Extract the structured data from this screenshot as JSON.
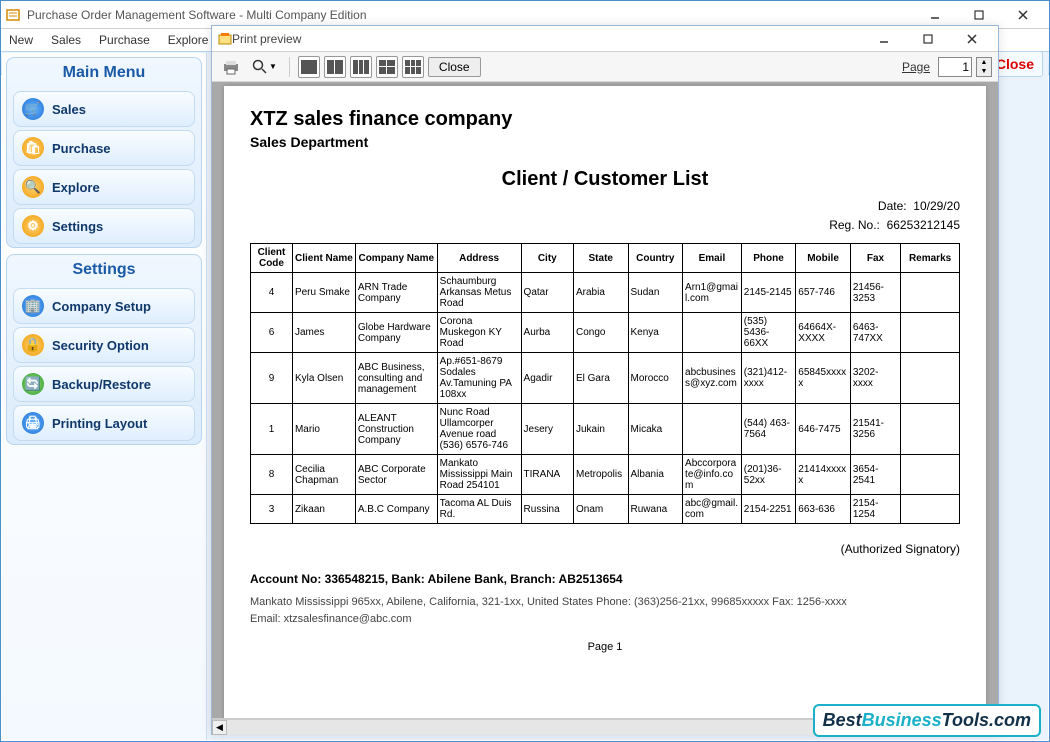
{
  "main_window": {
    "title": "Purchase Order Management Software - Multi Company Edition",
    "menu": [
      "New",
      "Sales",
      "Purchase",
      "Explore"
    ],
    "close_label": "Close"
  },
  "sidebar": {
    "main_menu_header": "Main Menu",
    "main_items": [
      {
        "label": "Sales"
      },
      {
        "label": "Purchase"
      },
      {
        "label": "Explore"
      },
      {
        "label": "Settings"
      }
    ],
    "settings_header": "Settings",
    "settings_items": [
      {
        "label": "Company Setup"
      },
      {
        "label": "Security Option"
      },
      {
        "label": "Backup/Restore"
      },
      {
        "label": "Printing Layout"
      }
    ]
  },
  "preview": {
    "title": "Print preview",
    "close_btn": "Close",
    "page_label": "Page",
    "page_value": "1"
  },
  "document": {
    "company": "XTZ sales finance company",
    "department": "Sales Department",
    "title": "Client / Customer List",
    "date_label": "Date:",
    "date_value": "10/29/20",
    "reg_label": "Reg. No.:",
    "reg_value": "66253212145",
    "columns": [
      "Client Code",
      "Client Name",
      "Company Name",
      "Address",
      "City",
      "State",
      "Country",
      "Email",
      "Phone",
      "Mobile",
      "Fax",
      "Remarks"
    ],
    "rows": [
      {
        "code": "4",
        "name": "Peru Smake",
        "company": "ARN Trade Company",
        "address": "Schaumburg Arkansas Metus Road",
        "city": "Qatar",
        "state": "Arabia",
        "country": "Sudan",
        "email": "Arn1@gmail.com",
        "phone": "2145-2145",
        "mobile": "657-746",
        "fax": "21456-3253",
        "remarks": ""
      },
      {
        "code": "6",
        "name": "James",
        "company": "Globe Hardware Company",
        "address": "Corona Muskegon KY Road",
        "city": "Aurba",
        "state": "Congo",
        "country": "Kenya",
        "email": "",
        "phone": "(535) 5436-66XX",
        "mobile": "64664X-XXXX",
        "fax": "6463-747XX",
        "remarks": ""
      },
      {
        "code": "9",
        "name": "Kyla Olsen",
        "company": "ABC Business, consulting and management",
        "address": "Ap.#651-8679 Sodales Av.Tamuning PA 108xx",
        "city": "Agadir",
        "state": "El Gara",
        "country": "Morocco",
        "email": "abcbusiness@xyz.com",
        "phone": "(321)412-xxxx",
        "mobile": "65845xxxxx",
        "fax": "3202-xxxx",
        "remarks": ""
      },
      {
        "code": "1",
        "name": "Mario",
        "company": "ALEANT Construction Company",
        "address": "Nunc Road Ullamcorper Avenue road (536) 6576-746",
        "city": "Jesery",
        "state": "Jukain",
        "country": "Micaka",
        "email": "",
        "phone": "(544) 463-7564",
        "mobile": "646-7475",
        "fax": "21541-3256",
        "remarks": ""
      },
      {
        "code": "8",
        "name": "Cecilia Chapman",
        "company": "ABC Corporate Sector",
        "address": "Mankato Mississippi Main Road 254101",
        "city": "TIRANA",
        "state": "Metropolis",
        "country": "Albania",
        "email": "Abccorporate@info.com",
        "phone": "(201)36-52xx",
        "mobile": "21414xxxxx",
        "fax": "3654-2541",
        "remarks": ""
      },
      {
        "code": "3",
        "name": "Zikaan",
        "company": "A.B.C Company",
        "address": "Tacoma AL Duis Rd.",
        "city": "Russina",
        "state": "Onam",
        "country": "Ruwana",
        "email": "abc@gmail.com",
        "phone": "2154-2251",
        "mobile": "663-636",
        "fax": "2154-1254",
        "remarks": ""
      }
    ],
    "signatory": "(Authorized Signatory)",
    "account_line": "Account No: 336548215, Bank: Abilene Bank, Branch: AB2513654",
    "footer_address": "Mankato Mississippi 965xx, Abilene, California, 321-1xx, United States  Phone: (363)256-21xx, 99685xxxxx  Fax: 1256-xxxx",
    "footer_email": "Email: xtzsalesfinance@abc.com",
    "page_number": "Page 1"
  },
  "watermark": {
    "pre": "Best",
    "mid": "Business",
    "post": "Tools.com"
  }
}
